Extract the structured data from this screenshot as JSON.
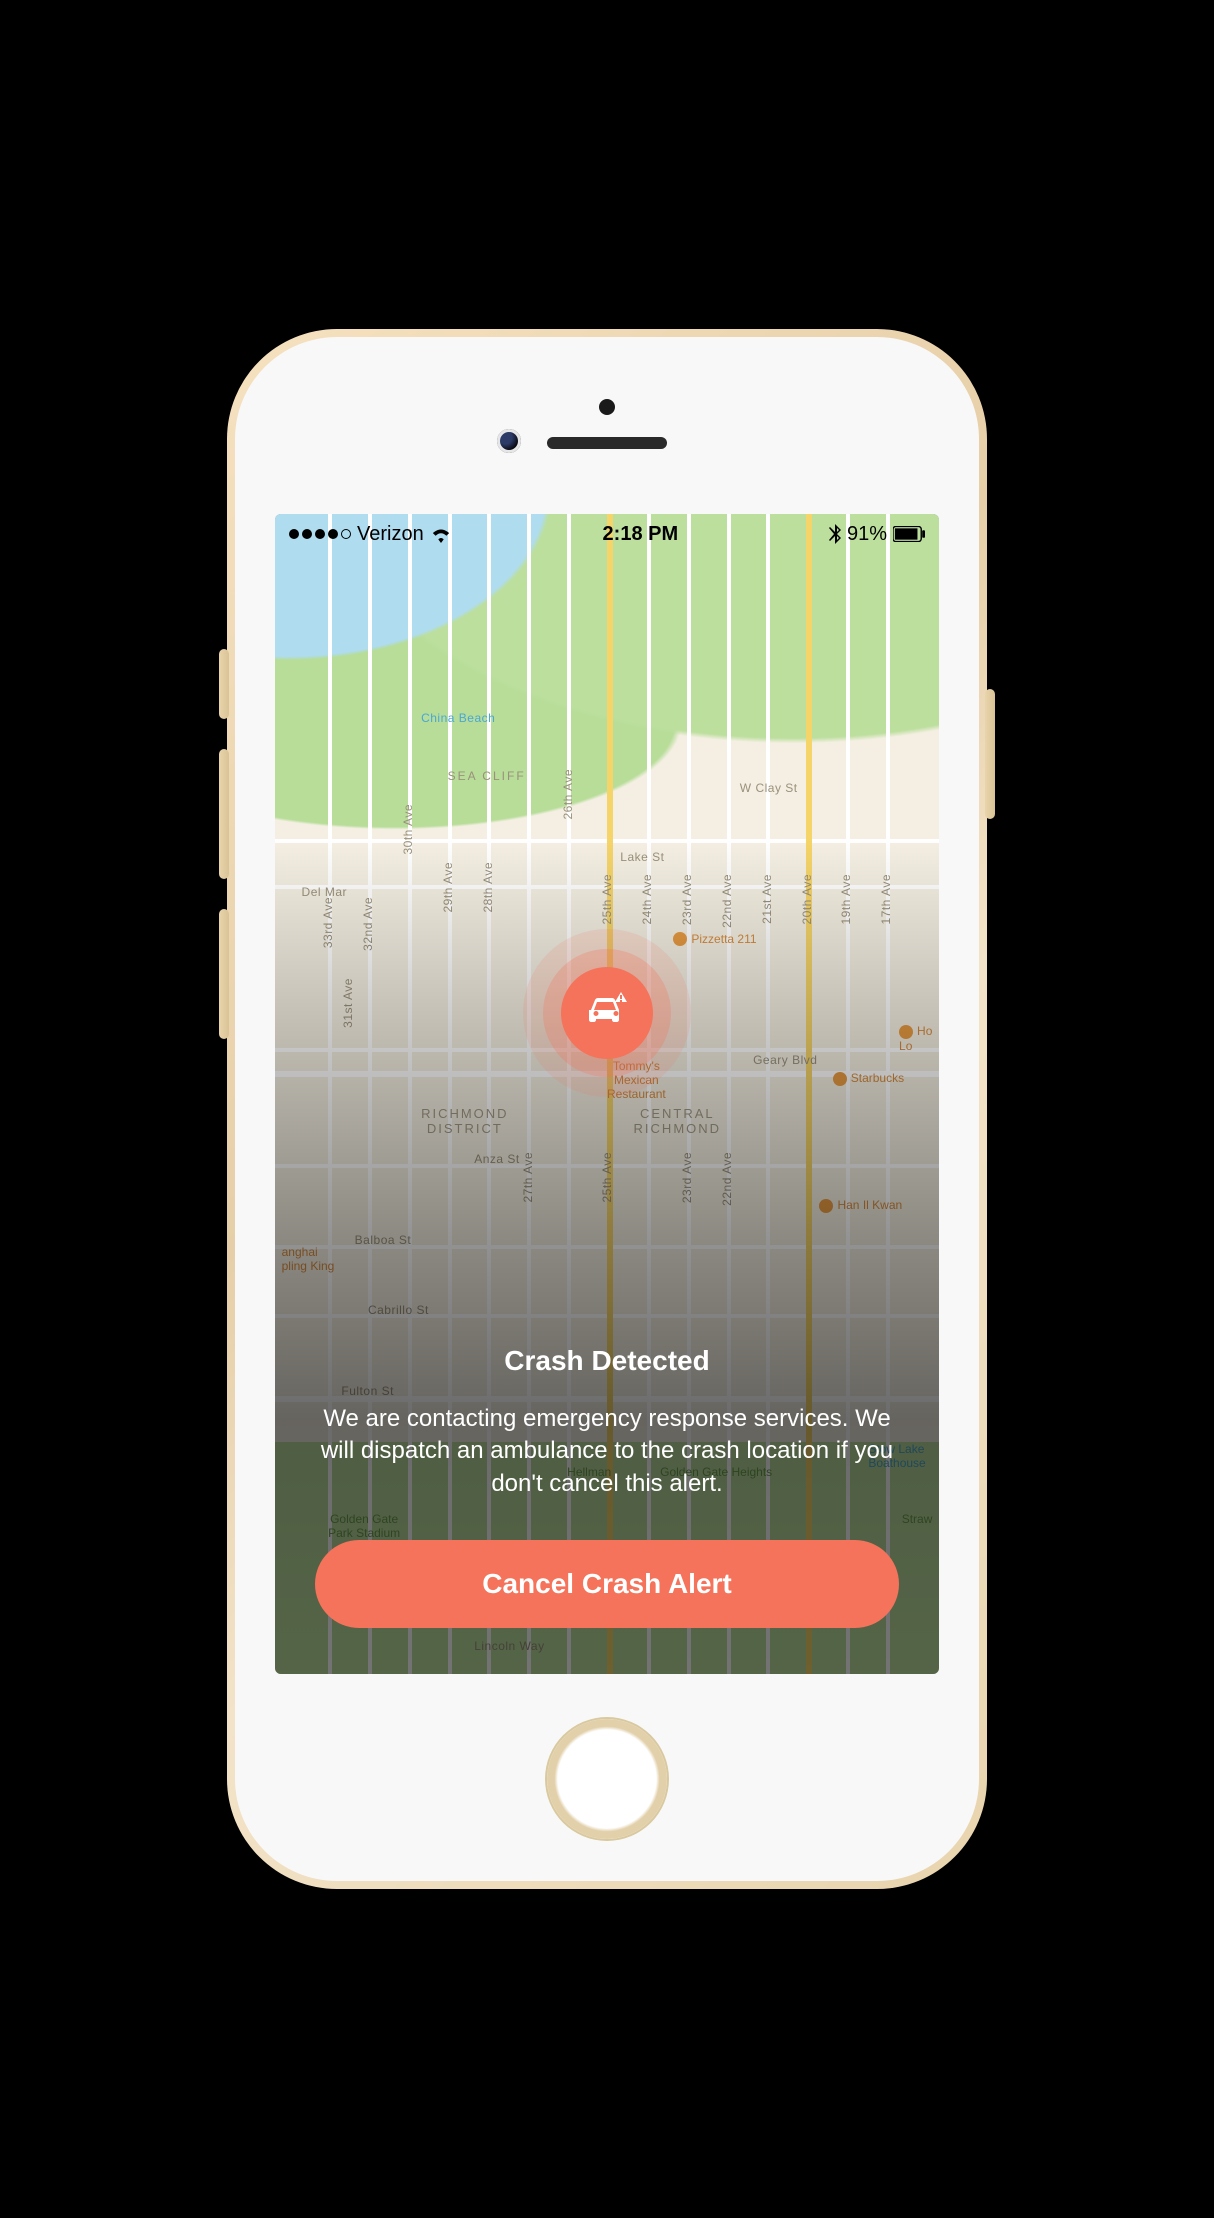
{
  "status_bar": {
    "carrier": "Verizon",
    "signal_filled": 4,
    "signal_total": 5,
    "time": "2:18 PM",
    "battery_pct": "91%"
  },
  "map": {
    "labels": {
      "china_beach": "China Beach",
      "sea_cliff": "SEA CLIFF",
      "del_mar": "Del Mar",
      "clay": "W Clay St",
      "lake": "Lake St",
      "geary": "Geary Blvd",
      "anza": "Anza St",
      "balboa": "Balboa St",
      "cabrillo": "Cabrillo St",
      "fulton": "Fulton St",
      "lincoln": "Lincoln Way",
      "av17": "17th Ave",
      "av19": "19th Ave",
      "av20": "20th Ave",
      "av21": "21st Ave",
      "av22": "22nd Ave",
      "av23": "23rd Ave",
      "av24": "24th Ave",
      "av25": "25th Ave",
      "av26": "26th Ave",
      "av27": "27th Ave",
      "av28": "28th Ave",
      "av29": "29th Ave",
      "av30": "30th Ave",
      "av31": "31st Ave",
      "av32": "32nd Ave",
      "av33": "33rd Ave"
    },
    "districts": {
      "richmond": "RICHMOND\nDISTRICT",
      "central": "CENTRAL\nRICHMOND"
    },
    "pois": {
      "pizzetta": "Pizzetta 211",
      "tommys": "Tommy's\nMexican\nRestaurant",
      "starbucks": "Starbucks",
      "hongkong": "Ho\nLo",
      "hanilkwan": "Han Il Kwan",
      "dumpling": "anghai\npling King",
      "ggpark": "Golden Gate\nPark Stadium",
      "hellman": "Hellman",
      "ggheights": "Golden Gate Heights",
      "stow": "Stow Lake\nBoathouse",
      "straw": "Straw"
    }
  },
  "alert": {
    "title": "Crash Detected",
    "body": "We are contacting emergency response services. We will dispatch an ambulance to the crash location if you don't cancel this alert.",
    "cancel_label": "Cancel Crash Alert"
  }
}
